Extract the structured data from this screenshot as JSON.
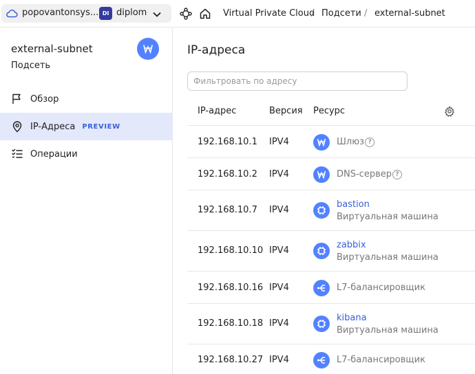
{
  "header": {
    "cloud_name": "popovantonsys...",
    "folder_badge": "DI",
    "folder_name": "diplom",
    "breadcrumbs": [
      "Virtual Private Cloud",
      "Подсети",
      "external-subnet"
    ],
    "separator": "/"
  },
  "sidebar": {
    "title": "external-subnet",
    "subtitle": "Подсеть",
    "items": [
      {
        "label": "Обзор",
        "icon": "flag-icon"
      },
      {
        "label": "IP-Адреса",
        "icon": "location-pin-icon",
        "badge": "PREVIEW",
        "active": true
      },
      {
        "label": "Операции",
        "icon": "checklist-icon"
      }
    ]
  },
  "main": {
    "title": "IP-адреса",
    "filter_placeholder": "Фильтровать по адресу",
    "columns": [
      "IP-адрес",
      "Версия",
      "Ресурс"
    ],
    "rows": [
      {
        "ip": "192.168.10.1",
        "version": "IPV4",
        "resource": "Шлюз",
        "type": "",
        "icon": "gateway-icon",
        "help": true
      },
      {
        "ip": "192.168.10.2",
        "version": "IPV4",
        "resource": "DNS-сервер",
        "type": "",
        "icon": "gateway-icon",
        "help": true
      },
      {
        "ip": "192.168.10.7",
        "version": "IPV4",
        "resource": "bastion",
        "type": "Виртуальная машина",
        "icon": "vm-icon",
        "link": true
      },
      {
        "ip": "192.168.10.10",
        "version": "IPV4",
        "resource": "zabbix",
        "type": "Виртуальная машина",
        "icon": "vm-icon",
        "link": true
      },
      {
        "ip": "192.168.10.16",
        "version": "IPV4",
        "resource": "L7-балансировщик",
        "type": "",
        "icon": "load-balancer-icon"
      },
      {
        "ip": "192.168.10.18",
        "version": "IPV4",
        "resource": "kibana",
        "type": "Виртуальная машина",
        "icon": "vm-icon",
        "link": true
      },
      {
        "ip": "192.168.10.27",
        "version": "IPV4",
        "resource": "L7-балансировщик",
        "type": "",
        "icon": "load-balancer-icon"
      }
    ]
  },
  "colors": {
    "accent": "#5282ff",
    "link": "#3a60d6",
    "active_bg": "#e3e8fb",
    "folder_badge": "#343a9e"
  }
}
